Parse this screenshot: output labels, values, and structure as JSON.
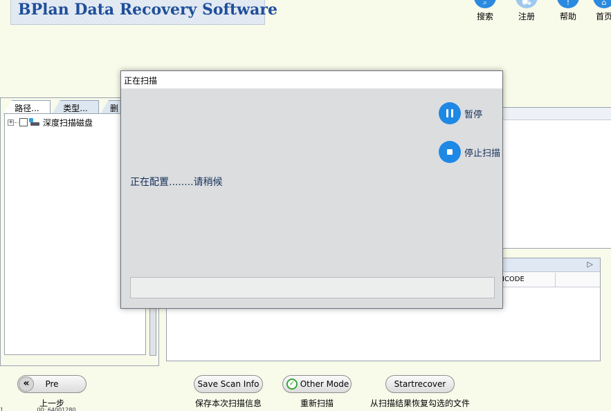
{
  "app": {
    "title": "BPlan Data Recovery Software"
  },
  "toolbar": {
    "items": [
      {
        "label": "搜索",
        "icon": "search-icon"
      },
      {
        "label": "注册",
        "icon": "cart-icon"
      },
      {
        "label": "帮助",
        "icon": "help-icon"
      },
      {
        "label": "首页",
        "icon": "home-icon"
      }
    ]
  },
  "left_panel": {
    "tabs": [
      "路径...",
      "类型...",
      "删"
    ],
    "tree_root": "深度扫描磁盘"
  },
  "file_list": {
    "columns": [
      "ICODE"
    ]
  },
  "status_line": "1  .................  00: 64001280",
  "bottom": {
    "pre_label": "Pre",
    "pre_icon": "«",
    "pre_caption": "上一步",
    "save_label": "Save Scan Info",
    "save_caption": "保存本次扫描信息",
    "other_label": "Other Mode",
    "other_caption": "重新扫描",
    "start_label": "Startrecover",
    "start_caption": "从扫描结果恢复勾选的文件"
  },
  "dialog": {
    "title": "正在扫描",
    "pause_label": "暂停",
    "stop_label": "停止扫描",
    "status": "正在配置........请稍候",
    "progress": 0
  },
  "colors": {
    "accent": "#1e88e5",
    "brand": "#1f4f9a",
    "background": "#f8faea"
  }
}
